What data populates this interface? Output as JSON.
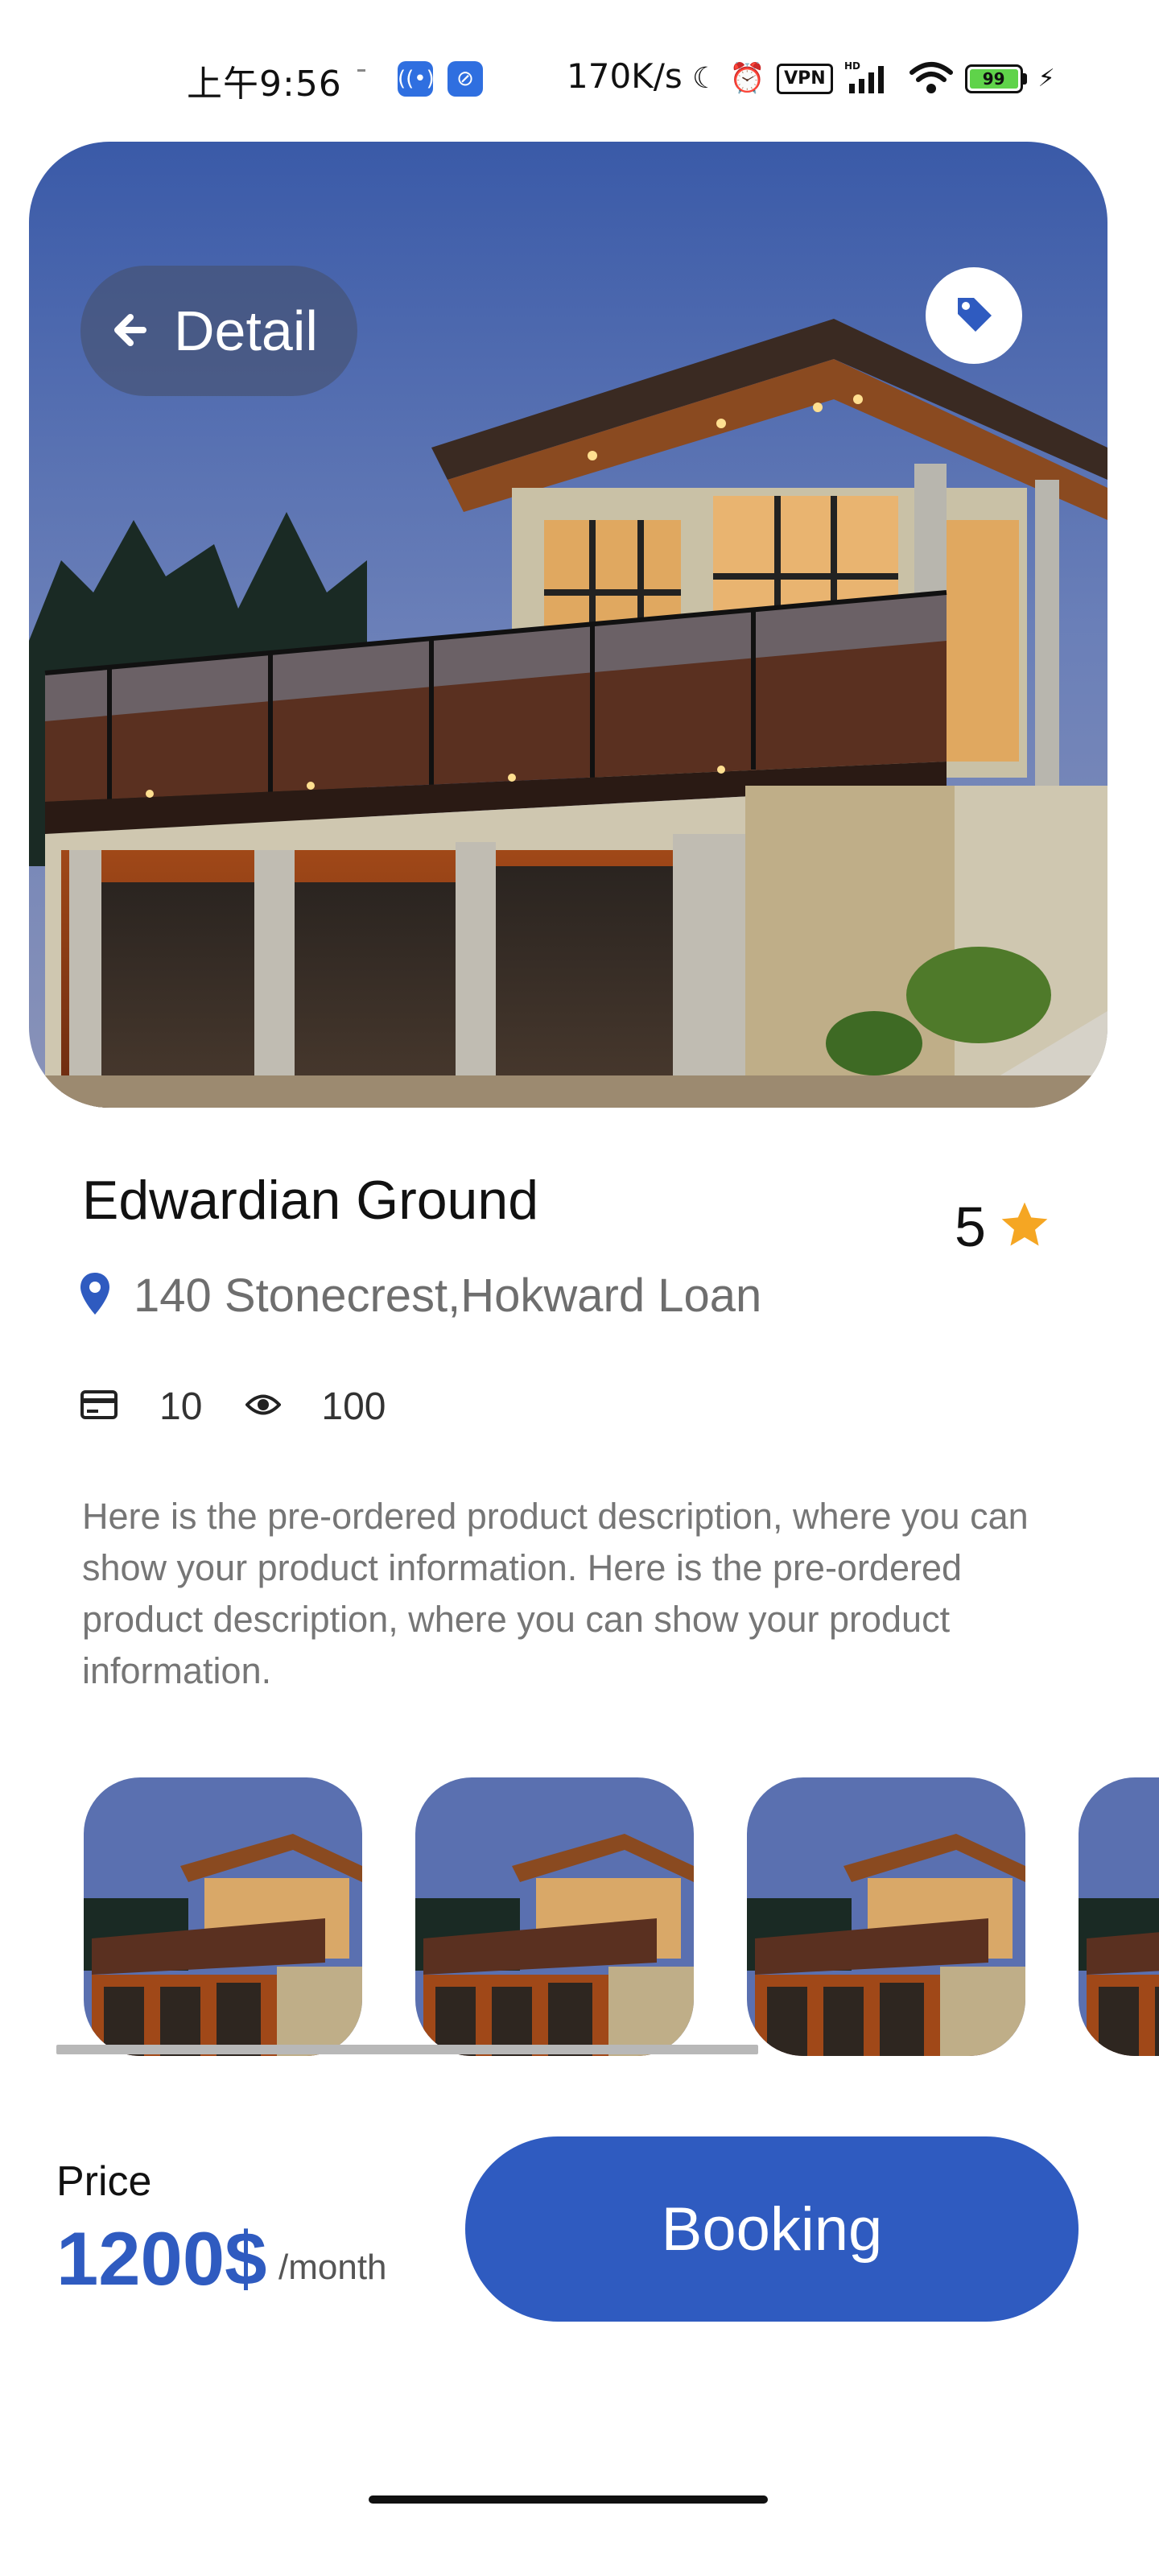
{
  "status_bar": {
    "time": "上午9:56",
    "app_icons": [
      "broadcast-icon",
      "shield-app-icon"
    ],
    "network_speed": "170K/s",
    "vpn_label": "VPN",
    "hd_label": "HD",
    "battery_level": "99"
  },
  "header": {
    "back_label": "Detail",
    "tag_icon": "tag-icon"
  },
  "property": {
    "title": "Edwardian Ground",
    "rating": "5",
    "address": "140 Stonecrest,Hokward Loan",
    "card_count": "10",
    "view_count": "100",
    "description": "Here is the pre-ordered product description, where you can show your product information. Here is the pre-ordered product description, where you can show your product information."
  },
  "gallery": {
    "thumbnail_count": 4
  },
  "footer": {
    "price_label": "Price",
    "price_value": "1200$",
    "price_unit": "/month",
    "booking_label": "Booking"
  },
  "colors": {
    "accent": "#2f5bc0",
    "star": "#f5a623",
    "battery": "#5fd34a"
  }
}
